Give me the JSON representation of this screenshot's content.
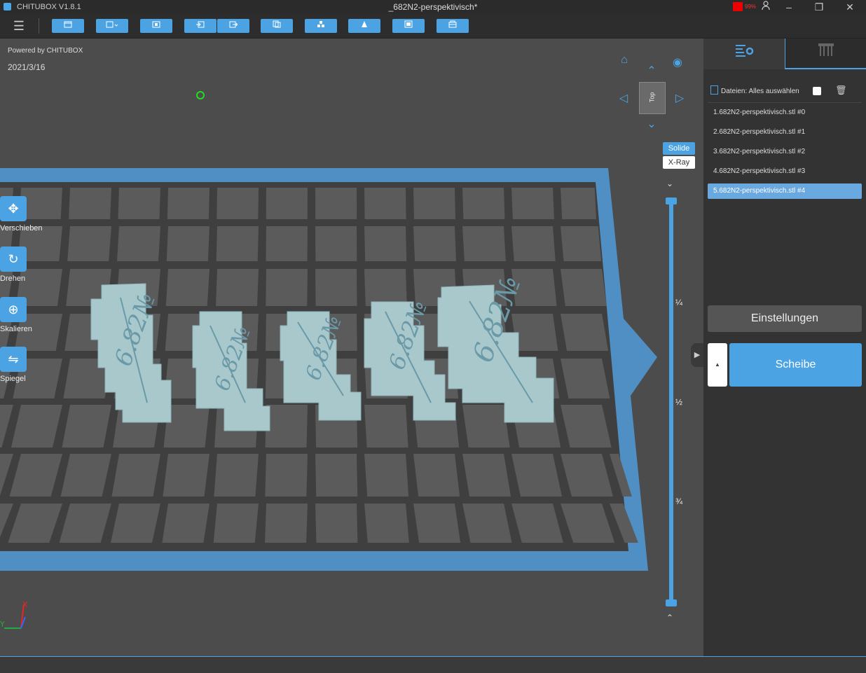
{
  "titlebar": {
    "app_name": "CHITUBOX V1.8.1",
    "document_title": "_682N2-perspektivisch*",
    "rec_percent": "99%",
    "minimize": "–",
    "maximize": "❐",
    "close": "✕"
  },
  "toolbar": {
    "menu_icon": "☰",
    "buttons": [
      "open-file-icon",
      "save-icon",
      "screenshot-icon",
      "import-icon",
      "export-icon",
      "copy-icon",
      "arrange-icon",
      "hollow-icon",
      "pattern-icon",
      "package-icon"
    ]
  },
  "viewport": {
    "powered_by": "Powered by CHITUBOX",
    "date": "2021/3/16",
    "tools": [
      {
        "label": "Verschieben",
        "icon": "✥"
      },
      {
        "label": "Drehen",
        "icon": "↻"
      },
      {
        "label": "Skalieren",
        "icon": "⊕"
      },
      {
        "label": "Spiegel",
        "icon": "⇋"
      }
    ],
    "view_cube_label": "Top",
    "view_modes": {
      "solid": "Solide",
      "xray": "X-Ray"
    },
    "layer_marks": [
      "¼",
      "½",
      "¾"
    ]
  },
  "sidebar": {
    "files_header": "Dateien: Alles auswählen",
    "files": [
      "1.682N2-perspektivisch.stl #0",
      "2.682N2-perspektivisch.stl #1",
      "3.682N2-perspektivisch.stl #2",
      "4.682N2-perspektivisch.stl #3",
      "5.682N2-perspektivisch.stl #4"
    ],
    "selected_index": 4,
    "settings_label": "Einstellungen",
    "slice_label": "Scheibe"
  },
  "colors": {
    "accent": "#4ba3e3",
    "background": "#4a4a4a",
    "platform": "#5b5b5b",
    "model": "#a9c8cc"
  }
}
